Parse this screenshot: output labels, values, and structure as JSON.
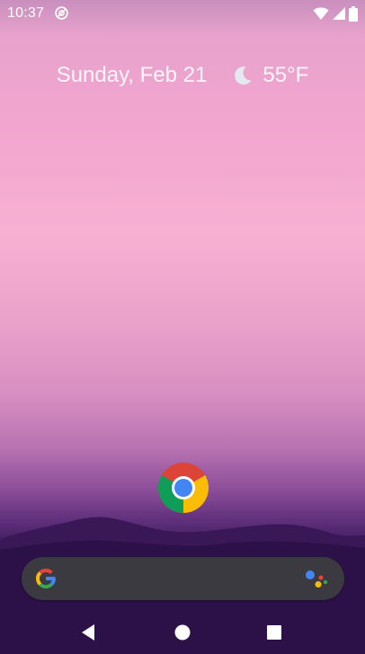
{
  "status_bar": {
    "time": "10:37",
    "left_icons": [
      "do-not-disturb-icon"
    ],
    "right_icons": [
      "wifi-icon",
      "cellular-signal-icon",
      "battery-icon"
    ]
  },
  "at_a_glance": {
    "date": "Sunday, Feb 21",
    "weather_icon": "moon-icon",
    "temperature": "55°F"
  },
  "home_screen": {
    "apps": [
      {
        "name": "chrome",
        "icon": "chrome-icon"
      }
    ]
  },
  "search_bar": {
    "left_icon": "google-g-icon",
    "right_icon": "google-assistant-icon"
  },
  "navigation_bar": {
    "buttons": [
      "back-icon",
      "home-icon",
      "recents-icon"
    ]
  },
  "colors": {
    "search_bar_bg": "#3b3a40",
    "wallpaper_top": "#e7a2cc",
    "wallpaper_bottom": "#22093a",
    "google_blue": "#4285f4",
    "google_red": "#ea4335",
    "google_yellow": "#fbbc05",
    "google_green": "#34a853"
  }
}
